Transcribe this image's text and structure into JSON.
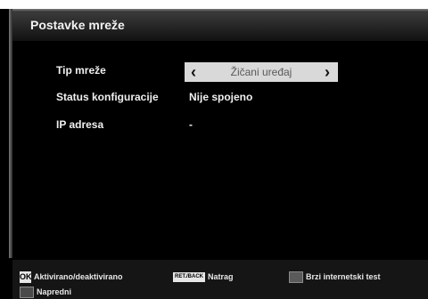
{
  "title": "Postavke mreže",
  "rows": [
    {
      "label": "Tip mreže",
      "value": "Žičani uređaj"
    },
    {
      "label": "Status konfiguracije",
      "value": "Nije spojeno"
    },
    {
      "label": "IP adresa",
      "value": "-"
    }
  ],
  "selector": {
    "left_icon": "‹",
    "right_icon": "›"
  },
  "footer": {
    "ok_key": "OK",
    "ok_label": "Aktivirano/deaktivirano",
    "back_key": "RET./BACK",
    "back_label": "Natrag",
    "test_label": "Brzi internetski test",
    "advanced_label": "Napredni",
    "colors": {
      "test_key": "#5a5a5a",
      "advanced_key": "#4a4a4a"
    }
  }
}
